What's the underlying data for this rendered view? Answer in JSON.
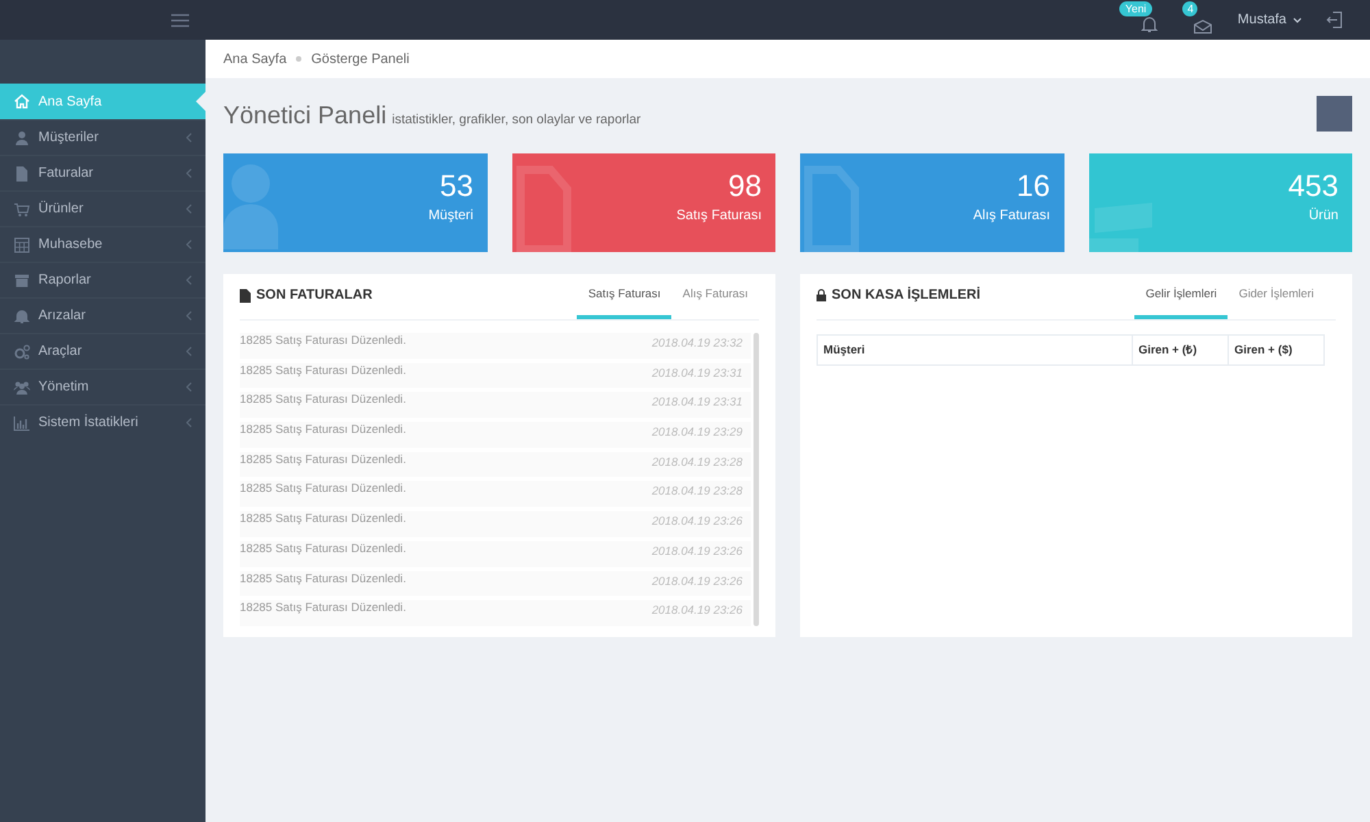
{
  "topbar": {
    "notification_badge": "Yeni",
    "message_badge": "4",
    "user": "Mustafa"
  },
  "sidebar": {
    "items": [
      {
        "label": "Ana Sayfa",
        "kind": "home",
        "selected": true
      },
      {
        "label": "Müşteriler",
        "kind": "user",
        "selected": false
      },
      {
        "label": "Faturalar",
        "kind": "file",
        "selected": false
      },
      {
        "label": "Ürünler",
        "kind": "cart",
        "selected": false
      },
      {
        "label": "Muhasebe",
        "kind": "calculator",
        "selected": false
      },
      {
        "label": "Raporlar",
        "kind": "archive",
        "selected": false
      },
      {
        "label": "Arızalar",
        "kind": "bell",
        "selected": false
      },
      {
        "label": "Araçlar",
        "kind": "gears",
        "selected": false
      },
      {
        "label": "Yönetim",
        "kind": "users",
        "selected": false
      },
      {
        "label": "Sistem İstatikleri",
        "kind": "chart",
        "selected": false
      }
    ]
  },
  "breadcrumb": [
    "Ana Sayfa",
    "Gösterge Paneli"
  ],
  "page_title": "Yönetici Paneli",
  "page_subtitle": "istatistikler, grafikler, son olaylar ve raporlar",
  "stats": [
    {
      "value": "53",
      "label": "Müşteri",
      "color": "#3598dc",
      "kind": "user"
    },
    {
      "value": "98",
      "label": "Satış Faturası",
      "color": "#e7505a",
      "kind": "file"
    },
    {
      "value": "16",
      "label": "Alış Faturası",
      "color": "#3598dc",
      "kind": "file"
    },
    {
      "value": "453",
      "label": "Ürün",
      "color": "#32c5d2",
      "kind": "box"
    }
  ],
  "invoices": {
    "title": "SON FATURALAR",
    "tabs": [
      {
        "label": "Satış Faturası",
        "selected": true
      },
      {
        "label": "Alış Faturası",
        "selected": false
      }
    ],
    "rows": [
      {
        "text": "18285 Satış Faturası Düzenledi.",
        "time": "2018.04.19 23:32"
      },
      {
        "text": "18285 Satış Faturası Düzenledi.",
        "time": "2018.04.19 23:31"
      },
      {
        "text": "18285 Satış Faturası Düzenledi.",
        "time": "2018.04.19 23:31"
      },
      {
        "text": "18285 Satış Faturası Düzenledi.",
        "time": "2018.04.19 23:29"
      },
      {
        "text": "18285 Satış Faturası Düzenledi.",
        "time": "2018.04.19 23:28"
      },
      {
        "text": "18285 Satış Faturası Düzenledi.",
        "time": "2018.04.19 23:28"
      },
      {
        "text": "18285 Satış Faturası Düzenledi.",
        "time": "2018.04.19 23:26"
      },
      {
        "text": "18285 Satış Faturası Düzenledi.",
        "time": "2018.04.19 23:26"
      },
      {
        "text": "18285 Satış Faturası Düzenledi.",
        "time": "2018.04.19 23:26"
      },
      {
        "text": "18285 Satış Faturası Düzenledi.",
        "time": "2018.04.19 23:26"
      }
    ]
  },
  "cash": {
    "title": "SON KASA İŞLEMLERİ",
    "tabs": [
      {
        "label": "Gelir İşlemleri",
        "selected": true
      },
      {
        "label": "Gider İşlemleri",
        "selected": false
      }
    ],
    "columns": [
      "Müşteri",
      "Giren + (₺)",
      "Giren + ($)"
    ]
  }
}
